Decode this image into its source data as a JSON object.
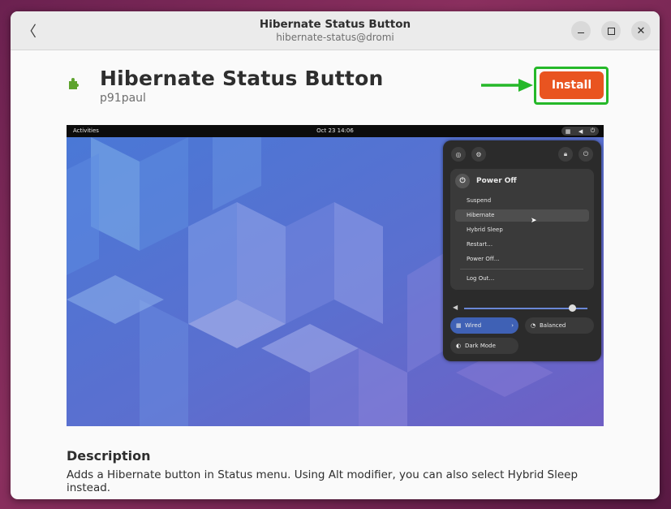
{
  "window": {
    "title": "Hibernate Status Button",
    "subtitle": "hibernate-status@dromi"
  },
  "app": {
    "name": "Hibernate Status Button",
    "author": "p91paul",
    "install_label": "Install"
  },
  "preview": {
    "topbar": {
      "activities": "Activities",
      "clock": "Oct 23  14:06"
    },
    "power_menu": {
      "title": "Power Off",
      "items": [
        "Suspend",
        "Hibernate",
        "Hybrid Sleep",
        "Restart…",
        "Power Off…",
        "Log Out…"
      ],
      "highlighted": "Hibernate"
    },
    "toggles": {
      "wired": "Wired",
      "balanced": "Balanced",
      "dark_mode": "Dark Mode"
    },
    "volume_level": 0.88
  },
  "description": {
    "heading": "Description",
    "text": "Adds a Hibernate button in Status menu. Using Alt modifier, you can also select Hybrid Sleep instead."
  },
  "colors": {
    "accent": "#e95420",
    "highlight_outline": "#25b829",
    "arrow": "#25b829"
  },
  "icons": [
    "back-icon",
    "minimize-icon",
    "maximize-icon",
    "close-icon",
    "puzzle-piece-icon",
    "arrow-right-icon"
  ]
}
